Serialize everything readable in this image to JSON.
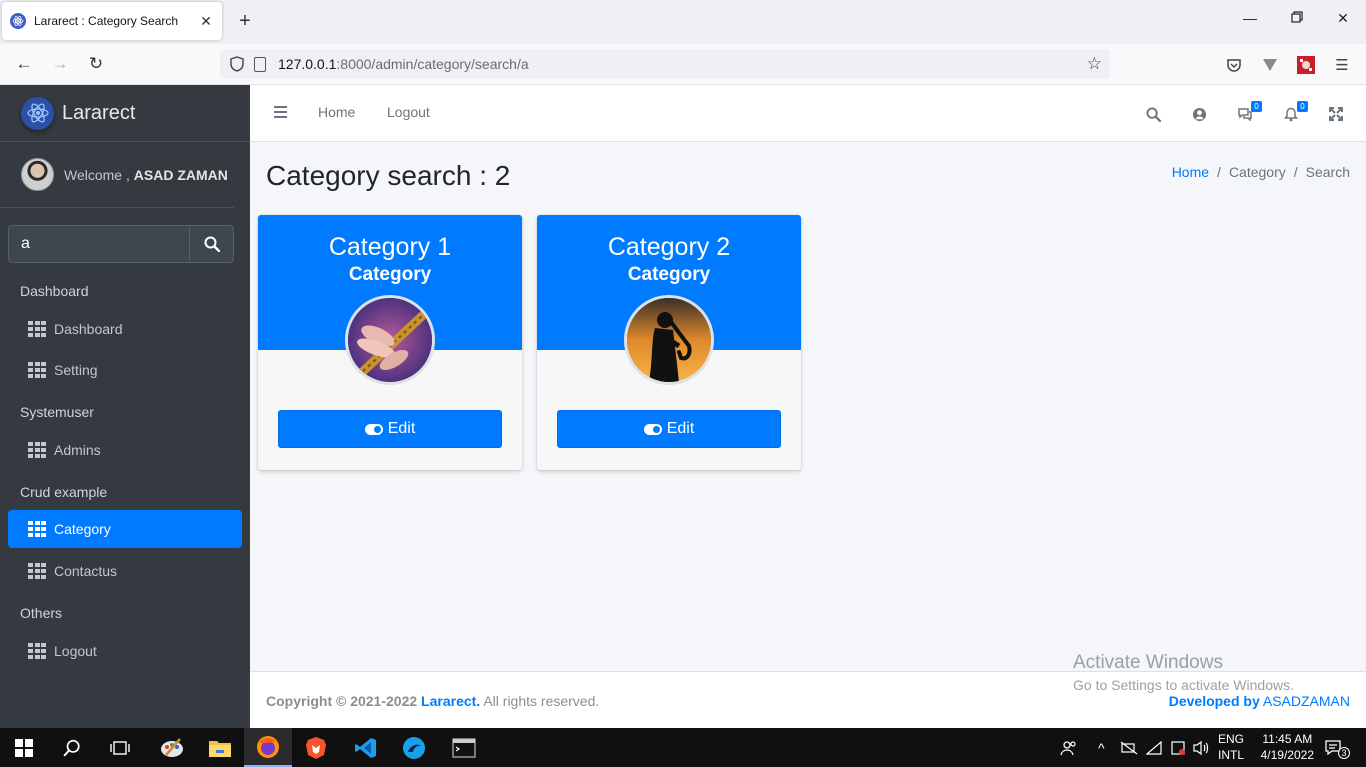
{
  "browser": {
    "tab_title": "Lararect : Category Search",
    "url_host": "127.0.0.1",
    "url_rest": ":8000/admin/category/search/a"
  },
  "sidebar": {
    "brand": "Lararect",
    "welcome_prefix": "Welcome ,",
    "user_name": "ASAD ZAMAN",
    "search_value": "a",
    "sections": [
      {
        "header": "Dashboard",
        "items": [
          "Dashboard",
          "Setting"
        ]
      },
      {
        "header": "Systemuser",
        "items": [
          "Admins"
        ]
      },
      {
        "header": "Crud example",
        "items": [
          "Category",
          "Contactus"
        ]
      },
      {
        "header": "Others",
        "items": [
          "Logout"
        ]
      }
    ],
    "active_item": "Category"
  },
  "topnav": {
    "home": "Home",
    "logout": "Logout",
    "messages_count": "0",
    "notifications_count": "0"
  },
  "page": {
    "title": "Category search : 2",
    "breadcrumb": [
      "Home",
      "Category",
      "Search"
    ]
  },
  "cards": [
    {
      "name": "Category 1",
      "subtitle": "Category",
      "button": "Edit",
      "image": "hands-playing-flute"
    },
    {
      "name": "Category 2",
      "subtitle": "Category",
      "button": "Edit",
      "image": "saxophone-player-silhouette"
    }
  ],
  "footer": {
    "copyright": "Copyright © 2021-2022",
    "brand": "Lararect.",
    "rights": "All rights reserved.",
    "dev_prefix": "Developed by",
    "dev_name": "ASADZAMAN"
  },
  "watermark": {
    "line1": "Activate Windows",
    "line2": "Go to Settings to activate Windows."
  },
  "taskbar": {
    "lang1": "ENG",
    "lang2": "INTL",
    "time": "11:45 AM",
    "date": "4/19/2022",
    "notif_count": "3"
  },
  "colors": {
    "primary": "#007bff",
    "sidebar": "#343a40",
    "content_bg": "#f4f6f9"
  }
}
